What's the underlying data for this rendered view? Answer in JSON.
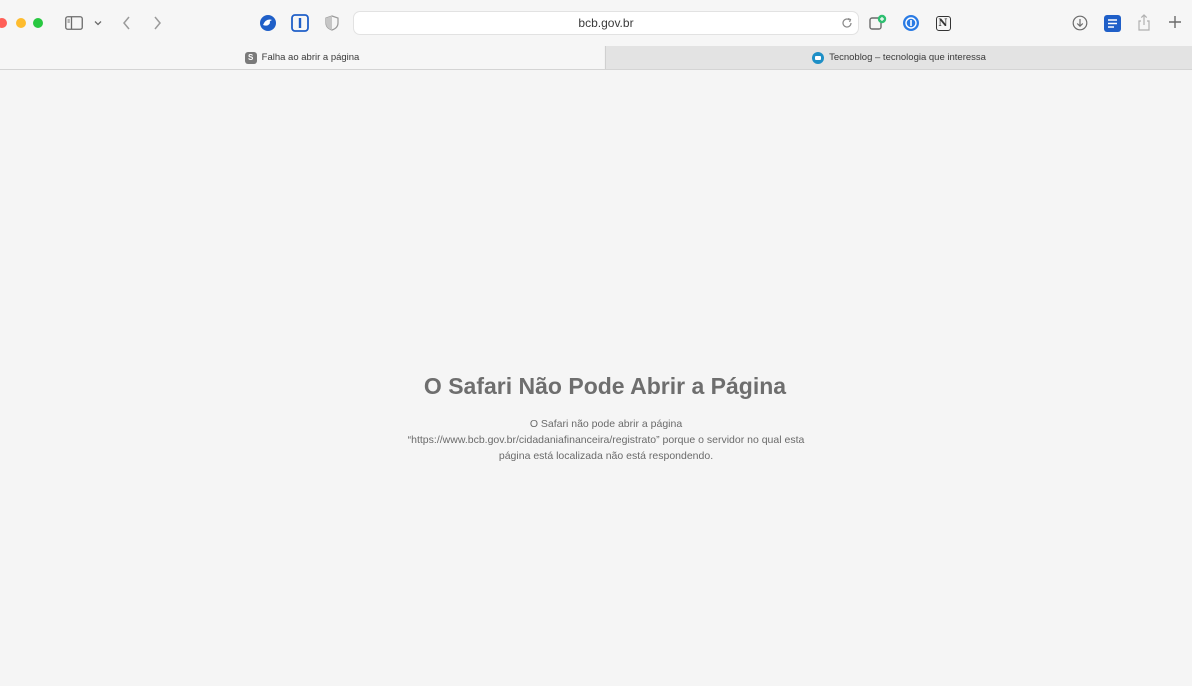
{
  "browser": {
    "address_bar": {
      "url": "bcb.gov.br"
    },
    "icons": {
      "sidebar": "sidebar-icon",
      "back": "chevron-left-icon",
      "forward": "chevron-right-icon",
      "privacy": "shield-icon",
      "reload": "reload-icon",
      "downloads": "download-icon",
      "share": "share-icon",
      "new_tab": "plus-icon"
    },
    "extensions": {
      "notion_letter": "N"
    }
  },
  "tabs": [
    {
      "label": "Falha ao abrir a página",
      "favicon_letter": "S",
      "active": true
    },
    {
      "label": "Tecnoblog – tecnologia que interessa",
      "active": false
    }
  ],
  "error_page": {
    "title": "O Safari Não Pode Abrir a Página",
    "message_lines": [
      "O Safari não pode abrir a página",
      "“https://www.bcb.gov.br/cidadaniafinanceira/registrato” porque o servidor no qual esta",
      "página está localizada não está respondendo."
    ]
  },
  "colors": {
    "close": "#ff5f57",
    "minimize": "#febc2e",
    "zoom": "#28c840",
    "accent_blue": "#1f5fc8",
    "background": "#f5f5f5"
  }
}
